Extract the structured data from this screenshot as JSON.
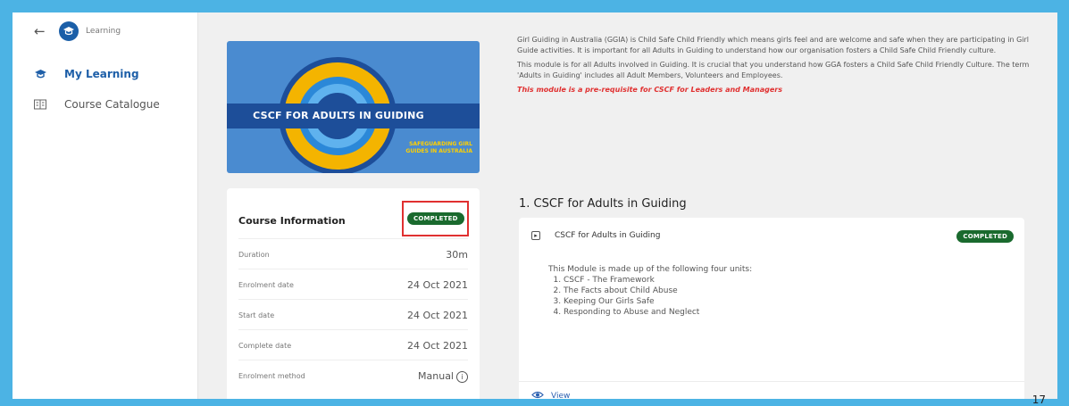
{
  "sidebar": {
    "brand_label": "Learning",
    "items": [
      {
        "label": "My Learning",
        "icon": "graduation-cap-icon"
      },
      {
        "label": "Course Catalogue",
        "icon": "catalogue-icon"
      }
    ]
  },
  "hero": {
    "title": "CSCF FOR ADULTS IN GUIDING",
    "safeguarding_text": "SAFEGUARDING GIRL GUIDES IN AUSTRALIA"
  },
  "course_info": {
    "title": "Course Information",
    "status": "COMPLETED",
    "rows": [
      {
        "label": "Duration",
        "value": "30m"
      },
      {
        "label": "Enrolment date",
        "value": "24 Oct 2021"
      },
      {
        "label": "Start date",
        "value": "24 Oct 2021"
      },
      {
        "label": "Complete date",
        "value": "24 Oct 2021"
      },
      {
        "label": "Enrolment method",
        "value": "Manual"
      }
    ]
  },
  "description": {
    "p1": "Girl Guiding in Australia (GGIA) is Child Safe Child Friendly which means girls feel and are welcome and safe when they are participating in Girl Guide activities. It is important for all Adults in Guiding to understand how our organisation fosters a Child Safe Child Friendly culture.",
    "p2": "This module is for all Adults involved in Guiding. It is crucial that you understand how GGA fosters a Child Safe Child Friendly Culture. The term 'Adults in Guiding' includes all Adult Members, Volunteers and Employees.",
    "prereq": "This module is a pre-requisite for CSCF for Leaders and Managers"
  },
  "section": {
    "title": "1. CSCF for Adults in Guiding",
    "module_title": "CSCF for Adults in Guiding",
    "status": "COMPLETED",
    "intro": "This Module is made up of the following four units:",
    "units": [
      "CSCF - The Framework",
      "The Facts about Child Abuse",
      "Keeping Our Girls Safe",
      "Responding to Abuse and Neglect"
    ],
    "view_label": "View"
  },
  "page_number": "17",
  "colors": {
    "frame": "#4cb3e4",
    "primary": "#1e5fa8",
    "completed": "#1a6a2e",
    "highlight": "#e03030"
  }
}
